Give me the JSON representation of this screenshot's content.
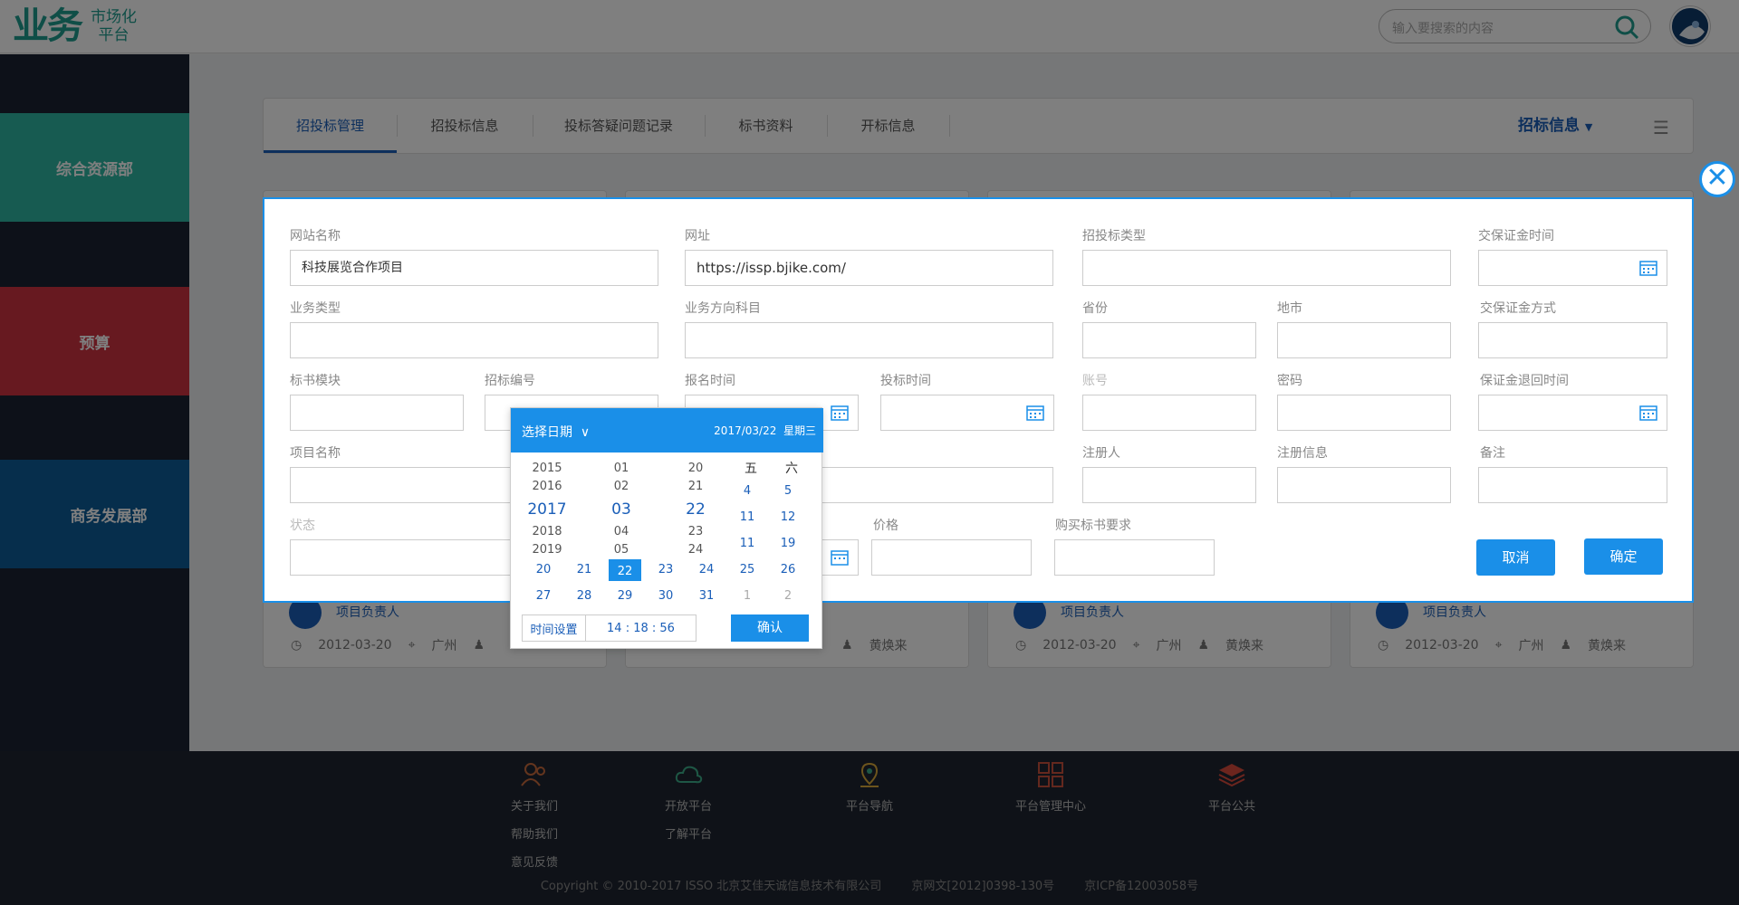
{
  "header": {
    "logo_main": "业务",
    "logo_sub_1": "市场化",
    "logo_sub_2": "平台",
    "search_placeholder": "输入要搜索的内容"
  },
  "sidebar": {
    "items": [
      {
        "label": "综合资源部",
        "color": "#2fb7a2"
      },
      {
        "label": "预算",
        "color": "#cf3240"
      },
      {
        "label": "商务发展部",
        "color": "#0d5c98"
      }
    ]
  },
  "tabs": {
    "items": [
      "招投标管理",
      "招投标信息",
      "投标答疑问题记录",
      "标书资料",
      "开标信息"
    ],
    "right_dropdown": "招标信息"
  },
  "cards": [
    {
      "person": "项目负责人",
      "date": "2012-03-20",
      "location": "广州",
      "owner": ""
    },
    {
      "person": "",
      "date": "",
      "location": "",
      "owner": "黄焕来"
    },
    {
      "person": "项目负责人",
      "date": "2012-03-20",
      "location": "广州",
      "owner": "黄焕来"
    },
    {
      "person": "项目负责人",
      "date": "2012-03-20",
      "location": "广州",
      "owner": "黄焕来"
    }
  ],
  "modal": {
    "fields": {
      "site_name_label": "网站名称",
      "site_name_value": "科技展览合作项目",
      "url_label": "网址",
      "url_value": "https://issp.bjike.com/",
      "bid_type_label": "招投标类型",
      "deposit_time_label": "交保证金时间",
      "biz_type_label": "业务类型",
      "biz_dir_label": "业务方向科目",
      "province_label": "省份",
      "city_label": "地市",
      "deposit_method_label": "交保证金方式",
      "doc_module_label": "标书模块",
      "bid_no_label": "招标编号",
      "signup_time_label": "报名时间",
      "bid_time_label": "投标时间",
      "account_label": "账号",
      "password_label": "密码",
      "deposit_return_label": "保证金退回时间",
      "project_name_label": "项目名称",
      "registrant_label": "注册人",
      "reg_info_label": "注册信息",
      "remark_label": "备注",
      "status_label": "状态",
      "price_label": "价格",
      "buy_req_label": "购买标书要求"
    },
    "cancel": "取消",
    "confirm": "确定"
  },
  "datepicker": {
    "title": "选择日期",
    "selected_date": "2017/03/22",
    "weekday": "星期三",
    "years": [
      "2015",
      "2016",
      "2017",
      "2018",
      "2019"
    ],
    "months": [
      "01",
      "02",
      "03",
      "04",
      "05"
    ],
    "days": [
      "20",
      "21",
      "22",
      "23",
      "24"
    ],
    "week_headers": [
      "五",
      "六"
    ],
    "grid": [
      [
        "",
        "",
        "",
        "",
        "",
        "4",
        "5"
      ],
      [
        "",
        "",
        "",
        "",
        "",
        "11",
        "12"
      ],
      [
        "",
        "",
        "",
        "",
        "",
        "11",
        "19"
      ],
      [
        "20",
        "21",
        "22",
        "23",
        "24",
        "25",
        "26"
      ],
      [
        "27",
        "28",
        "29",
        "30",
        "31",
        "1",
        "2"
      ]
    ],
    "time_label": "时间设置",
    "time_value": "14 : 18 : 56",
    "ok": "确认"
  },
  "footer": {
    "cols": [
      {
        "title": "关于我们",
        "links": [
          "帮助我们",
          "意见反馈"
        ]
      },
      {
        "title": "开放平台",
        "links": [
          "了解平台"
        ]
      },
      {
        "title": "平台导航",
        "links": []
      },
      {
        "title": "平台管理中心",
        "links": []
      },
      {
        "title": "平台公共",
        "links": []
      }
    ],
    "copyright": "Copyright © 2010-2017 ISSO 北京艾佳天诚信息技术有限公司",
    "license1": "京网文[2012]0398-130号",
    "license2": "京ICP备12003058号"
  }
}
